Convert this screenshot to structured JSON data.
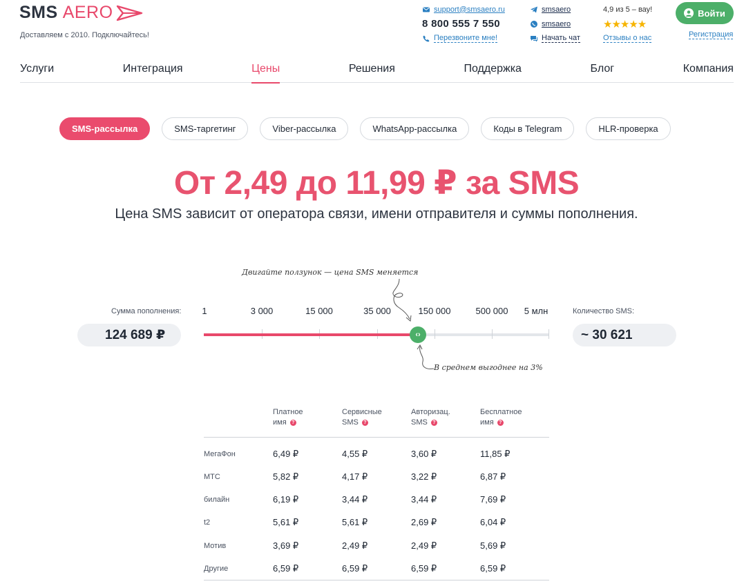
{
  "brand": {
    "name_a": "SMS",
    "name_b": "AERO",
    "tagline": "Доставляем с 2010. Подключайтесь!"
  },
  "contacts": {
    "email": "support@smsaero.ru",
    "phone": "8 800 555 7 550",
    "callback": "Перезвоните мне!",
    "telegram": "smsaero",
    "whatsapp": "smsaero",
    "chat": "Начать чат",
    "rating": "4,9 из 5 – вау!",
    "reviews": "Отзывы о нас",
    "login": "Войти",
    "register": "Регистрация"
  },
  "nav": [
    "Услуги",
    "Интеграция",
    "Цены",
    "Решения",
    "Поддержка",
    "Блог",
    "Компания"
  ],
  "nav_active": "Цены",
  "pills": [
    "SMS-рассылка",
    "SMS-таргетинг",
    "Viber-рассылка",
    "WhatsApp-рассылка",
    "Коды в Telegram",
    "HLR-проверка"
  ],
  "pill_active": "SMS-рассылка",
  "headline": "От 2,49 до 11,99 ₽ за SMS",
  "subline": "Цена SMS зависит от оператора связи, имени отправителя и суммы пополнения.",
  "slider": {
    "hint_top": "Двигайте ползунок — цена SMS меняется",
    "hint_bottom": "В среднем выгоднее на 3%",
    "amount_label": "Сумма пополнения:",
    "amount_value": "124 689 ₽",
    "count_label": "Количество SMS:",
    "count_value": "~ 30 621",
    "ticks": [
      "1",
      "3 000",
      "15 000",
      "35 000",
      "150 000",
      "500 000",
      "5 млн"
    ],
    "knob_symbol": "‹›",
    "position_fraction": 0.62
  },
  "table": {
    "headers": [
      {
        "line1": "Платное",
        "line2": "имя"
      },
      {
        "line1": "Сервисные",
        "line2": "SMS"
      },
      {
        "line1": "Авторизац.",
        "line2": "SMS"
      },
      {
        "line1": "Бесплатное",
        "line2": "имя"
      }
    ],
    "help_symbol": "?",
    "rows": [
      {
        "operator": "МегаФон",
        "values": [
          "6,49 ₽",
          "4,55 ₽",
          "3,60 ₽",
          "11,85 ₽"
        ]
      },
      {
        "operator": "МТС",
        "values": [
          "5,82 ₽",
          "4,17 ₽",
          "3,22 ₽",
          "6,87 ₽"
        ]
      },
      {
        "operator": "билайн",
        "values": [
          "6,19 ₽",
          "3,44 ₽",
          "3,44 ₽",
          "7,69 ₽"
        ]
      },
      {
        "operator": "t2",
        "values": [
          "5,61 ₽",
          "5,61 ₽",
          "2,69 ₽",
          "6,04 ₽"
        ]
      },
      {
        "operator": "Мотив",
        "values": [
          "3,69 ₽",
          "2,49 ₽",
          "2,49 ₽",
          "5,69 ₽"
        ]
      },
      {
        "operator": "Другие",
        "values": [
          "6,59 ₽",
          "6,59 ₽",
          "6,59 ₽",
          "6,59 ₽"
        ]
      }
    ]
  },
  "colors": {
    "accent": "#e8486b",
    "green": "#4caf69",
    "link": "#2a7fc1",
    "star": "#f6b400"
  }
}
